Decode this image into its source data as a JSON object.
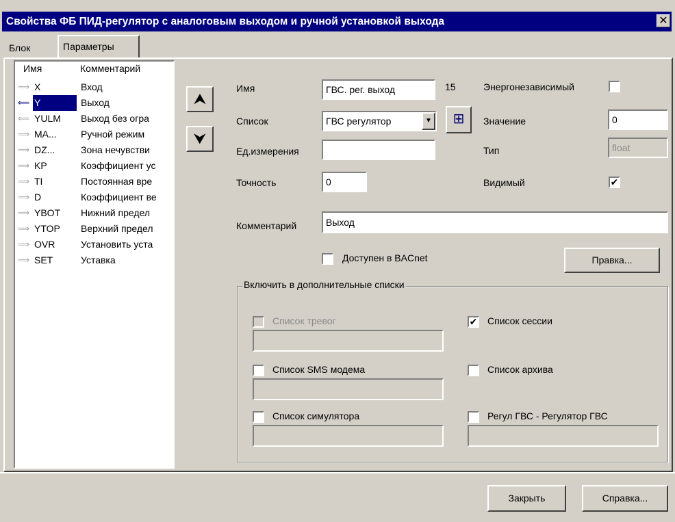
{
  "window": {
    "title": "Свойства ФБ ПИД-регулятор с аналоговым выходом и ручной установкой выхода",
    "close_glyph": "✕"
  },
  "tabs": [
    {
      "label": "Блок",
      "active": false
    },
    {
      "label": "Параметры",
      "active": true
    }
  ],
  "param_list": {
    "headers": {
      "name": "Имя",
      "comment": "Комментарий"
    },
    "rows": [
      {
        "arrow": "⟹",
        "name": "X",
        "comment": "Вход",
        "selected": false
      },
      {
        "arrow": "⟸",
        "name": "Y",
        "comment": "Выход",
        "selected": true
      },
      {
        "arrow": "⟸",
        "name": "YULM",
        "comment": "Выход без огра",
        "selected": false
      },
      {
        "arrow": "⟹",
        "name": "MA...",
        "comment": "Ручной режим",
        "selected": false
      },
      {
        "arrow": "⟹",
        "name": "DZ...",
        "comment": "Зона нечувстви",
        "selected": false
      },
      {
        "arrow": "⟹",
        "name": "KP",
        "comment": "Коэффициент ус",
        "selected": false
      },
      {
        "arrow": "⟹",
        "name": "TI",
        "comment": "Постоянная вре",
        "selected": false
      },
      {
        "arrow": "⟹",
        "name": "D",
        "comment": "Коэффициент ве",
        "selected": false
      },
      {
        "arrow": "⟹",
        "name": "YBOT",
        "comment": "Нижний предел",
        "selected": false
      },
      {
        "arrow": "⟹",
        "name": "YTOP",
        "comment": "Верхний предел",
        "selected": false
      },
      {
        "arrow": "⟹",
        "name": "OVR",
        "comment": "Установить уста",
        "selected": false
      },
      {
        "arrow": "⟹",
        "name": "SET",
        "comment": "Уставка",
        "selected": false
      }
    ]
  },
  "move_buttons": {
    "up": "⮝",
    "down": "⮟"
  },
  "form": {
    "name_label": "Имя",
    "name_value": "ГВС. рег. выход",
    "index": "15",
    "nonvolatile_label": "Энергонезависимый",
    "nonvolatile_checked": "",
    "list_label": "Список",
    "list_value": "ГВС регулятор",
    "list_dd_glyph": "▼",
    "list_add_glyph": "⊞",
    "value_label": "Значение",
    "value_value": "0",
    "units_label": "Ед.измерения",
    "units_value": "",
    "type_label": "Тип",
    "type_value": "float",
    "precision_label": "Точность",
    "precision_value": "0",
    "visible_label": "Видимый",
    "visible_checked": "✔",
    "comment_label": "Комментарий",
    "comment_value": "Выход",
    "bacnet_label": "Доступен в BACnet",
    "bacnet_checked": "",
    "edit_button": "Правка..."
  },
  "extra_lists": {
    "title": "Включить в дополнительные списки",
    "alarms": {
      "label": "Список тревог",
      "checked": "",
      "value": ""
    },
    "session": {
      "label": "Список сессии",
      "checked": "✔"
    },
    "sms": {
      "label": "Список SMS модема",
      "checked": "",
      "value": ""
    },
    "archive": {
      "label": "Список архива",
      "checked": ""
    },
    "simulator": {
      "label": "Список симулятора",
      "checked": "",
      "value": ""
    },
    "regul": {
      "label": "Регул ГВС - Регулятор ГВС",
      "checked": "",
      "value": ""
    }
  },
  "footer": {
    "close_button": "Закрыть",
    "help_button": "Справка..."
  }
}
